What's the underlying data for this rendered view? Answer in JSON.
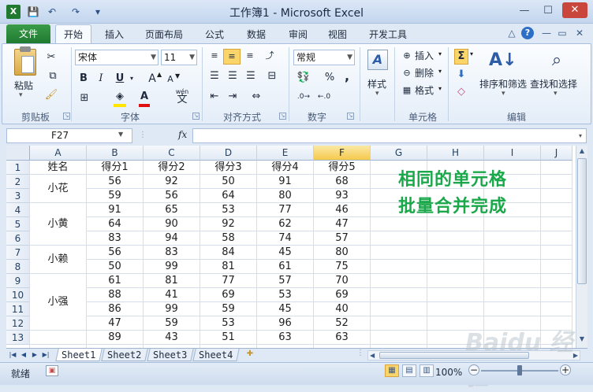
{
  "window": {
    "title": "工作簿1 - Microsoft Excel",
    "quick_access": {
      "save": "💾",
      "undo": "↶",
      "redo": "↷",
      "customize": "▾"
    },
    "controls": {
      "minimize": "—",
      "maximize": "☐",
      "close": "✕"
    }
  },
  "tabs": {
    "file": "文件",
    "items": [
      "开始",
      "插入",
      "页面布局",
      "公式",
      "数据",
      "审阅",
      "视图",
      "开发工具"
    ],
    "active": "开始",
    "right": {
      "collapse": "△",
      "help": "?",
      "min": "—",
      "restore": "▭",
      "close": "✕"
    }
  },
  "ribbon": {
    "clipboard": {
      "paste": "粘贴",
      "label": "剪贴板"
    },
    "font": {
      "name": "宋体",
      "size": "11",
      "bold": "B",
      "italic": "I",
      "underline": "U",
      "grow": "A",
      "shrink": "A",
      "font_color": "A",
      "wen": "wén",
      "wen_char": "文",
      "label": "字体"
    },
    "alignment": {
      "label": "对齐方式"
    },
    "number": {
      "format": "常规",
      "percent": "%",
      "comma": ",",
      "label": "数字"
    },
    "styles": {
      "label": "样式"
    },
    "cells": {
      "insert": "插入",
      "delete": "删除",
      "format": "格式",
      "label": "单元格"
    },
    "editing": {
      "sum": "Σ",
      "sort_filter": "排序和筛选",
      "find_select": "查找和选择",
      "label": "编辑"
    }
  },
  "formula_bar": {
    "name_box": "F27",
    "fx": "fx",
    "formula": ""
  },
  "sheet": {
    "columns": [
      "A",
      "B",
      "C",
      "D",
      "E",
      "F",
      "G",
      "H",
      "I",
      "J"
    ],
    "selected_column": "F",
    "rows": [
      "1",
      "2",
      "3",
      "4",
      "5",
      "6",
      "7",
      "8",
      "9",
      "10",
      "11",
      "12",
      "13"
    ],
    "header": [
      "姓名",
      "得分1",
      "得分2",
      "得分3",
      "得分4",
      "得分5"
    ],
    "names": [
      "小花",
      "小黄",
      "小赖",
      "小强"
    ],
    "scores": [
      [
        "56",
        "92",
        "50",
        "91",
        "68"
      ],
      [
        "59",
        "56",
        "64",
        "80",
        "93"
      ],
      [
        "91",
        "65",
        "53",
        "77",
        "46"
      ],
      [
        "64",
        "90",
        "92",
        "62",
        "47"
      ],
      [
        "83",
        "94",
        "58",
        "74",
        "57"
      ],
      [
        "56",
        "83",
        "84",
        "45",
        "80"
      ],
      [
        "50",
        "99",
        "81",
        "61",
        "75"
      ],
      [
        "61",
        "81",
        "77",
        "57",
        "70"
      ],
      [
        "88",
        "41",
        "69",
        "53",
        "69"
      ],
      [
        "86",
        "99",
        "59",
        "45",
        "40"
      ],
      [
        "47",
        "59",
        "53",
        "96",
        "52"
      ],
      [
        "89",
        "43",
        "51",
        "63",
        "63"
      ]
    ],
    "annotation": [
      "相同的单元格",
      "批量合并完成"
    ]
  },
  "sheet_tabs": [
    "Sheet1",
    "Sheet2",
    "Sheet3",
    "Sheet4"
  ],
  "active_sheet": "Sheet1",
  "status": {
    "ready": "就绪",
    "zoom": "100%",
    "zoom_out": "−",
    "zoom_in": "+"
  },
  "watermark": "Baidu 经验"
}
